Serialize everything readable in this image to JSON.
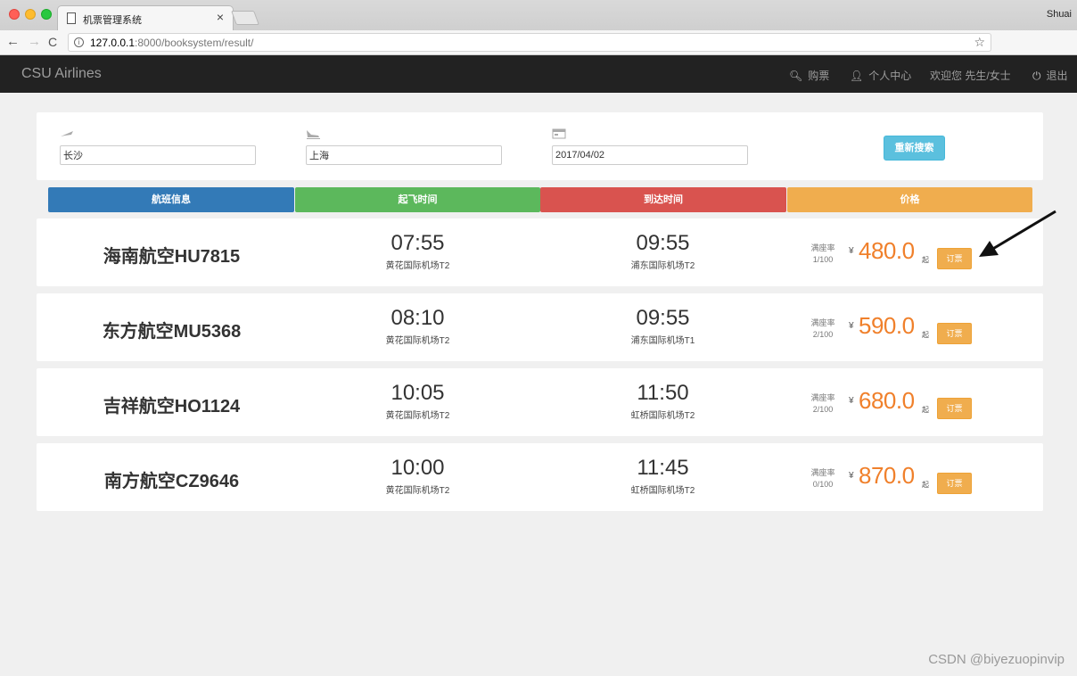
{
  "browser": {
    "tab_title": "机票管理系统",
    "tab_close": "×",
    "user": "Shuai",
    "url_host": "127.0.0.1",
    "url_rest": ":8000/booksystem/result/",
    "back_icon": "←",
    "forward_icon": "→",
    "reload_icon": "C",
    "star_icon": "☆",
    "menu_icon": "⋮"
  },
  "navbar": {
    "brand": "CSU Airlines",
    "buy": "购票",
    "center": "个人中心",
    "welcome": "欢迎您 先生/女士",
    "logout": "退出"
  },
  "search": {
    "from": "长沙",
    "to": "上海",
    "date": "2017/04/02",
    "button": "重新搜索"
  },
  "columns": {
    "info": "航班信息",
    "departure": "起飞时间",
    "arrival": "到达时间",
    "price": "价格"
  },
  "labels": {
    "seat_rate": "满座率",
    "currency": "¥",
    "from_suffix": "起",
    "book": "订票"
  },
  "flights": [
    {
      "name": "海南航空HU7815",
      "dep_time": "07:55",
      "dep_airport": "黄花国际机场T2",
      "arr_time": "09:55",
      "arr_airport": "浦东国际机场T2",
      "seats": "1/100",
      "price": "480.0"
    },
    {
      "name": "东方航空MU5368",
      "dep_time": "08:10",
      "dep_airport": "黄花国际机场T2",
      "arr_time": "09:55",
      "arr_airport": "浦东国际机场T1",
      "seats": "2/100",
      "price": "590.0"
    },
    {
      "name": "吉祥航空HO1124",
      "dep_time": "10:05",
      "dep_airport": "黄花国际机场T2",
      "arr_time": "11:50",
      "arr_airport": "虹桥国际机场T2",
      "seats": "2/100",
      "price": "680.0"
    },
    {
      "name": "南方航空CZ9646",
      "dep_time": "10:00",
      "dep_airport": "黄花国际机场T2",
      "arr_time": "11:45",
      "arr_airport": "虹桥国际机场T2",
      "seats": "0/100",
      "price": "870.0"
    }
  ],
  "watermark": "CSDN @biyezuopinvip"
}
